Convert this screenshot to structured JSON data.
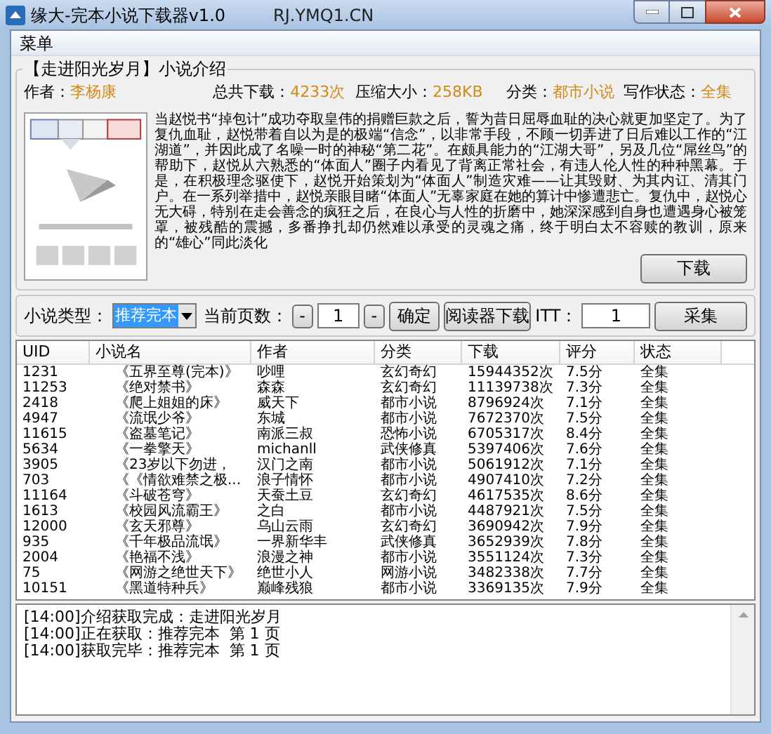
{
  "window": {
    "title": "缘大-完本小说下载器v1.0",
    "url": "RJ.YMQ1.CN"
  },
  "menu": [
    "菜单"
  ],
  "intro": {
    "title": "【走进阳光岁月】小说介绍",
    "fields": [
      {
        "label": "作者：",
        "value": "李杨康"
      },
      {
        "label": "总共下载：",
        "value": "4233次"
      },
      {
        "label": "压缩大小：",
        "value": "258KB"
      },
      {
        "label": "分类：",
        "value": "都市小说"
      },
      {
        "label": "写作状态：",
        "value": "全集"
      }
    ],
    "description": "当赵悦书“掉包计”成功夺取皇伟的捐赠巨款之后，誓为昔日屈辱血耻的决心就更加坚定了。为了复仇血耻，赵悦带着自以为是的极端“信念”，以非常手段，不顾一切弄进了日后难以工作的“江湖道”，并因此成了名噪一时的神秘“第二花”。在颇具能力的“江湖大哥”，另及几位“屌丝鸟”的帮助下，赵悦从六熟悉的“体面人”圈子内看见了背离正常社会，有违人伦人性的种种黑幕。于是，在积极理念驱使下，赵悦开始策划为“体面人”制造灾难——让其毁财、为其内讧、清其门户。在一系列举措中，赵悦亲眼目睹“体面人”无辜家庭在她的算计中惨遭悲亡。复仇中，赵悦心无大碍，特别在走会善念的疯狂之后，在良心与人性的折磨中，她深深感到自身也遭遇身心被笼罩，被残酷的震撼，多番挣扎却仍然难以承受的灵魂之痛，终于明白太不容赎的教训，原来的“雄心”同此淡化",
    "download_button": "下载"
  },
  "controls": {
    "type_label": "小说类型：",
    "type_value": "推荐完本",
    "page_label": "当前页数：",
    "minus": "-",
    "page_value": "1",
    "plus": "-",
    "confirm": "确定",
    "reader": "阅读器下载",
    "thread_label": "ITT：",
    "thread_value": "1",
    "collect": "采集"
  },
  "table": {
    "columns": [
      "UID",
      "小说名",
      "作者",
      "分类",
      "下载",
      "评分",
      "状态"
    ],
    "rows": [
      [
        "1231",
        "《五界至尊(完本)》",
        "吵哩",
        "玄幻奇幻",
        "15944352次",
        "7.5分",
        "全集"
      ],
      [
        "11253",
        "《绝对禁书》",
        "森森",
        "玄幻奇幻",
        "11139738次",
        "7.3分",
        "全集"
      ],
      [
        "2418",
        "《爬上姐姐的床》",
        "威天下",
        "都市小说",
        "8796924次",
        "7.1分",
        "全集"
      ],
      [
        "4947",
        "《流氓少爷》",
        "东城",
        "都市小说",
        "7672370次",
        "7.5分",
        "全集"
      ],
      [
        "11615",
        "《盗墓笔记》",
        "南派三叔",
        "恐怖小说",
        "6705317次",
        "8.4分",
        "全集"
      ],
      [
        "5634",
        "《一拳擎天》",
        "michanll",
        "武侠修真",
        "5397406次",
        "7.6分",
        "全集"
      ],
      [
        "3905",
        "《23岁以下勿进，",
        "汉门之南",
        "都市小说",
        "5061912次",
        "7.1分",
        "全集"
      ],
      [
        "703",
        "《《情欲难禁之极...",
        "浪子情怀",
        "都市小说",
        "4907410次",
        "7.2分",
        "全集"
      ],
      [
        "11164",
        "《斗破苍穹》",
        "天蚕土豆",
        "玄幻奇幻",
        "4617535次",
        "8.6分",
        "全集"
      ],
      [
        "1613",
        "《校园风流霸王》",
        "之白",
        "都市小说",
        "4487921次",
        "7.5分",
        "全集"
      ],
      [
        "12000",
        "《玄天邪尊》",
        "乌山云雨",
        "玄幻奇幻",
        "3690942次",
        "7.9分",
        "全集"
      ],
      [
        "935",
        "《千年极品流氓》",
        "一界新华丰",
        "武侠修真",
        "3652939次",
        "7.8分",
        "全集"
      ],
      [
        "2004",
        "《艳福不浅》",
        "浪漫之神",
        "都市小说",
        "3551124次",
        "7.3分",
        "全集"
      ],
      [
        "75",
        "《网游之绝世天下》",
        "绝世小人",
        "网游小说",
        "3482338次",
        "7.7分",
        "全集"
      ],
      [
        "10151",
        "《黑道特种兵》",
        "巅峰残狼",
        "都市小说",
        "3369135次",
        "7.9分",
        "全集"
      ]
    ]
  },
  "log": [
    "[14:00]介绍获取完成：走进阳光岁月",
    "[14:00]正在获取：推荐完本  第 1 页",
    "[14:00]获取完毕：推荐完本  第 1 页"
  ]
}
